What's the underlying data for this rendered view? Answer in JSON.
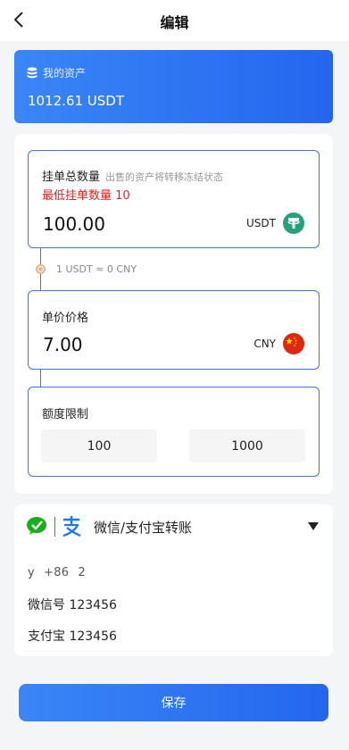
{
  "header": {
    "title": "编辑"
  },
  "assets": {
    "label": "我的资产",
    "value": "1012.61 USDT"
  },
  "quantity": {
    "label": "挂单总数量",
    "hint": "出售的资产将转移冻结状态",
    "min_note": "最低挂单数量 10",
    "value": "100.00",
    "unit": "USDT"
  },
  "rate": {
    "text": "1 USDT ≈ 0 CNY"
  },
  "price": {
    "label": "单价价格",
    "value": "7.00",
    "unit": "CNY"
  },
  "limit": {
    "label": "额度限制",
    "min": "100",
    "max": "1000"
  },
  "payment": {
    "method": "微信/支付宝转账",
    "name": "y",
    "country_code": "+86",
    "phone": "2",
    "wechat": "微信号 123456",
    "alipay": "支付宝 123456"
  },
  "save_label": "保存",
  "colors": {
    "accent": "#2466ef",
    "border": "#3f74e6",
    "error": "#e02020",
    "tether": "#26a17b",
    "china": "#de2910"
  }
}
